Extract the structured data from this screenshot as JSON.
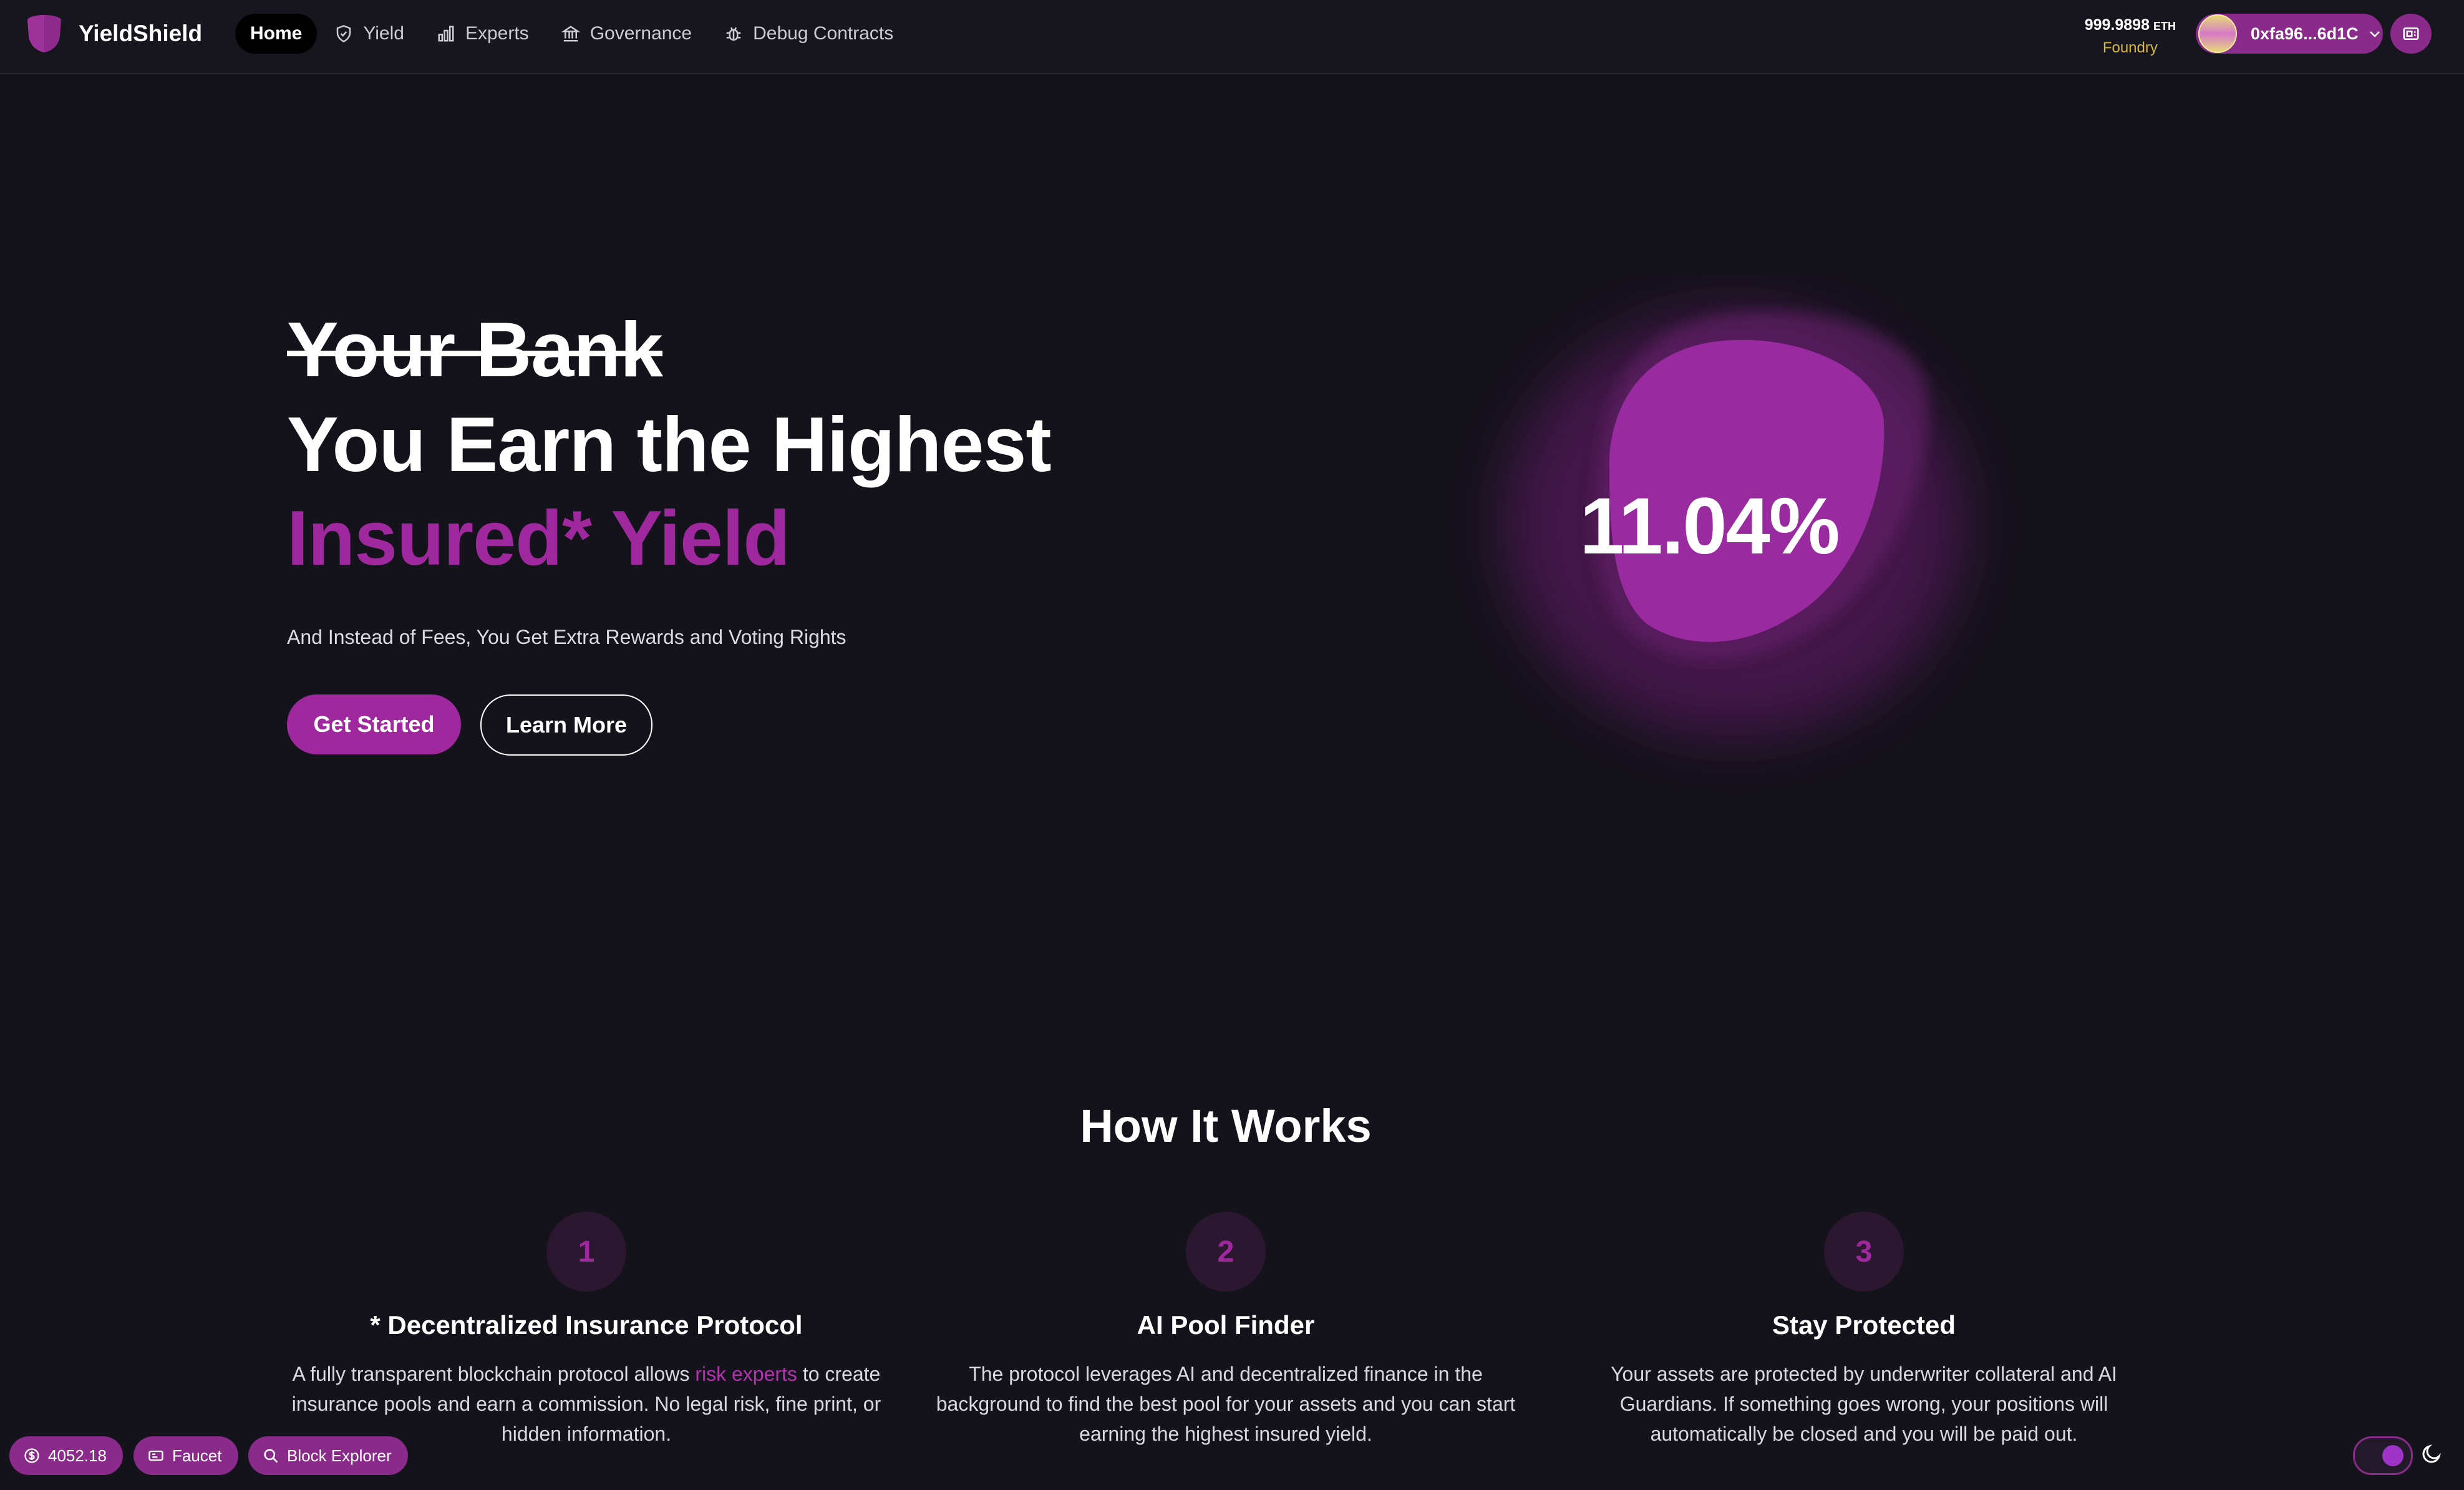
{
  "brand": {
    "name": "YieldShield",
    "icon": "shield-logo-icon",
    "color": "#8e2a8c"
  },
  "nav": {
    "items": [
      {
        "label": "Home",
        "icon": "",
        "active": true
      },
      {
        "label": "Yield",
        "icon": "shield-icon",
        "active": false
      },
      {
        "label": "Experts",
        "icon": "bar-chart-icon",
        "active": false
      },
      {
        "label": "Governance",
        "icon": "bank-icon",
        "active": false
      },
      {
        "label": "Debug Contracts",
        "icon": "bug-icon",
        "active": false
      }
    ]
  },
  "wallet": {
    "balance": "999.9898",
    "unit": "ETH",
    "network": "Foundry",
    "address": "0xfa96...6d1C",
    "menu_icon": "chevron-down-icon",
    "qr_icon": "wallet-icon"
  },
  "hero": {
    "strike_text": "Your Bank",
    "title": "You Earn the Highest",
    "accent": "Insured* Yield",
    "subtitle": "And Instead of Fees, You Get Extra Rewards and Voting Rights",
    "primary_button": "Get Started",
    "secondary_button": "Learn More",
    "apy": "11.04%"
  },
  "how_it_works": {
    "title": "How It Works",
    "steps": [
      {
        "number": "1",
        "title": "* Decentralized Insurance Protocol",
        "desc_before": "A fully transparent blockchain protocol allows ",
        "desc_link": "risk experts",
        "desc_after": " to create insurance pools and earn a commission. No legal risk, fine print, or hidden information."
      },
      {
        "number": "2",
        "title": "AI Pool Finder",
        "desc": "The protocol leverages AI and decentralized finance in the background to find the best pool for your assets and you can start earning the highest insured yield."
      },
      {
        "number": "3",
        "title": "Stay Protected",
        "desc": "Your assets are protected by underwriter collateral and AI Guardians. If something goes wrong, your positions will automatically be closed and you will be paid out."
      }
    ]
  },
  "footer": {
    "price": "4052.18",
    "faucet": "Faucet",
    "explorer": "Block Explorer"
  },
  "theme": {
    "accent": "#a0289e",
    "background": "#14121b",
    "dark_mode": true
  }
}
